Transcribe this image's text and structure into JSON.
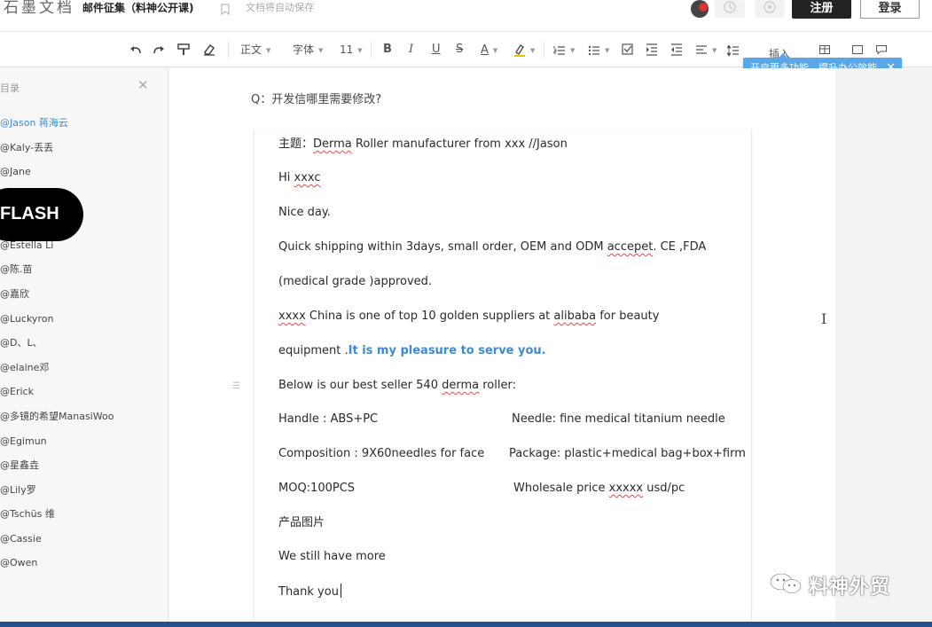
{
  "app": {
    "logo": "石墨文档",
    "doc_title": "邮件征集（料神公开课)",
    "autosave": "文档将自动保存",
    "register": "注册",
    "login": "登录"
  },
  "toolbar": {
    "paragraph": "正文",
    "font": "字体",
    "size": "11",
    "insert": "插入",
    "tooltip": "开启更多功能，提升办公效能",
    "tooltip_close": "✕"
  },
  "sidebar": {
    "title": "目录",
    "close": "✕",
    "flash": "FLASH",
    "items": [
      "@Jason  蒋海云",
      "@Kaly-丢丢",
      "@Jane",
      "@Estella Li",
      "@陈.苗",
      "@嘉欣",
      "@Luckyron",
      "@D、L、",
      "@elaine邓",
      "@Erick",
      "@多镜的希望ManasiWoo",
      "@Egimun",
      "@星鑫垚",
      "@Lily罗",
      "@Tschüs 维",
      "@Cassie",
      "@Owen"
    ]
  },
  "content": {
    "question": "Q：开发信哪里需要修改?",
    "subject_prefix": "主题：",
    "subject_derma": "Derma",
    "subject_rest": " Roller manufacturer from xxx //Jason",
    "hi": "Hi   ",
    "hi_name": "xxxc",
    "nice_day": "Nice day.",
    "shipping_a": "Quick shipping within 3days, small order, OEM and ODM ",
    "shipping_accepet": "accepet",
    "shipping_b": ".   CE ,FDA",
    "medical": "(medical grade )approved.",
    "china_xxxx": "xxxx",
    "china_a": " China is one of top 10 golden suppliers at ",
    "china_alibaba": "alibaba",
    "china_b": "   for   beauty",
    "equipment": "equipment .",
    "pleasure": "It is my pleasure to serve you.",
    "best_a": "Below is   our best seller 540 ",
    "best_derma": "derma",
    "best_b": " roller:",
    "handle": "Handle : ABS+PC",
    "needle": "Needle: fine medical titanium needle",
    "composition": "Composition : 9X60needles for face",
    "package": "Package: plastic+medical bag+box+firm",
    "moq": "MOQ:100PCS",
    "wholesale_a": "Wholesale price ",
    "wholesale_xxxxx": "xxxxx",
    "wholesale_b": " usd/pc",
    "photos": "产品图片",
    "more": "We still have more",
    "thanks": "Thank you"
  },
  "watermark": "料神外贸",
  "colors": {
    "accent": "#3d8ad8",
    "tooltip": "#5aa6e6",
    "register_bg": "#222222",
    "bottom_bar": "#23508e"
  }
}
